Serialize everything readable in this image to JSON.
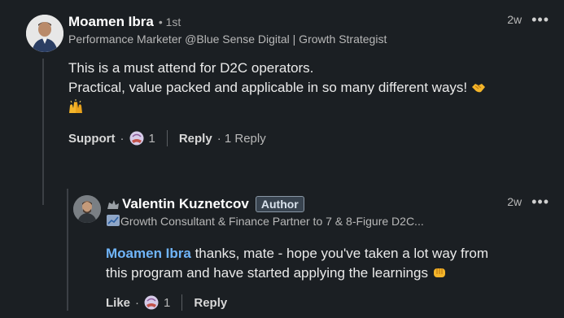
{
  "main_comment": {
    "author": "Moamen Ibra",
    "degree": "• 1st",
    "headline": "Performance Marketer @Blue Sense Digital | Growth Strategist",
    "time": "2w",
    "menu": "•••",
    "body_line1": "This is a must attend for D2C operators.",
    "body_line2": "Practical, value packed and applicable in so many different ways!",
    "emoji_1": "handshake-emoji",
    "emoji_2": "raised-hands-emoji",
    "support_label": "Support",
    "dot": "·",
    "reaction_count": "1",
    "reply_label": "Reply",
    "reply_count": "· 1 Reply"
  },
  "reply_comment": {
    "author": "Valentin Kuznetcov",
    "author_badge": "Author",
    "headline": "Growth Consultant & Finance Partner to 7 & 8-Figure D2C...",
    "time": "2w",
    "menu": "•••",
    "mention": "Moamen Ibra",
    "body_rest_line1": " thanks, mate - hope you've taken a lot way from",
    "body_line2": "this program and have started applying the learnings",
    "emoji": "fist-bump-emoji",
    "like_label": "Like",
    "dot": "·",
    "reaction_count": "1",
    "reply_label": "Reply"
  },
  "colors": {
    "background": "#1b1f23",
    "mention": "#70b5f9",
    "text": "#eaeaea",
    "muted": "#b8b8b8"
  }
}
